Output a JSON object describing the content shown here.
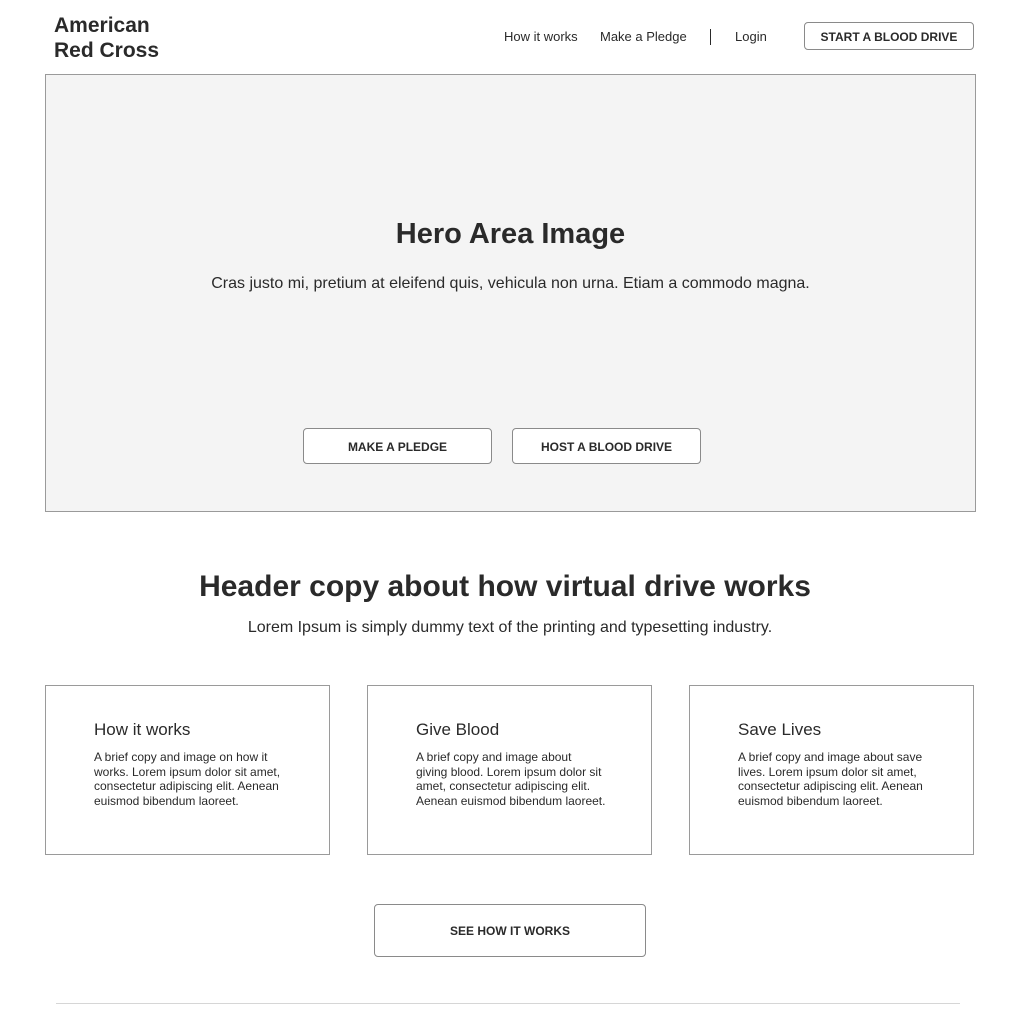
{
  "header": {
    "logo_line1": "American",
    "logo_line2": "Red Cross",
    "nav": {
      "how_it_works": "How it works",
      "make_a_pledge": "Make a Pledge",
      "login": "Login",
      "cta": "START A BLOOD DRIVE"
    }
  },
  "hero": {
    "title": "Hero Area Image",
    "subtitle": "Cras justo mi, pretium at eleifend quis, vehicula non urna. Etiam a commodo magna.",
    "primary_button": "MAKE A PLEDGE",
    "secondary_button": "HOST A BLOOD DRIVE"
  },
  "section": {
    "header": "Header copy about how virtual drive works",
    "subheader": "Lorem Ipsum is simply dummy text of the printing and typesetting industry."
  },
  "cards": [
    {
      "title": "How it works",
      "body": "A brief copy and image on how it works. Lorem ipsum dolor sit amet, consectetur adipiscing elit. Aenean euismod bibendum laoreet."
    },
    {
      "title": "Give Blood",
      "body": "A brief copy and image about giving blood. Lorem ipsum dolor sit amet, consectetur adipiscing elit. Aenean euismod bibendum laoreet."
    },
    {
      "title": "Save Lives",
      "body": "A brief copy and image about save lives. Lorem ipsum dolor sit amet, consectetur adipiscing elit. Aenean euismod bibendum laoreet."
    }
  ],
  "see_how_button": "SEE HOW IT WORKS"
}
